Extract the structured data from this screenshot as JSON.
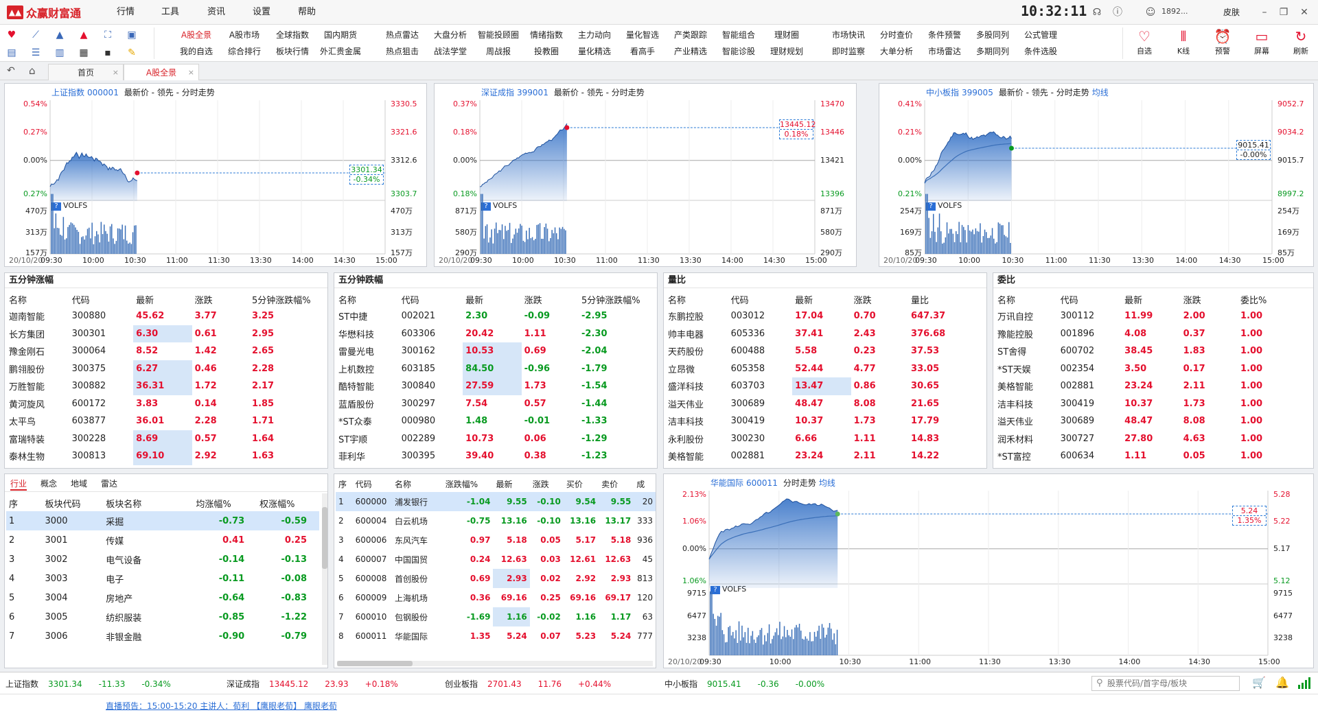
{
  "app": {
    "name": "众赢财富通",
    "menu": [
      "行情",
      "工具",
      "资讯",
      "设置",
      "帮助"
    ],
    "clock": "10:32:11",
    "user": "1892...",
    "skin": "皮肤"
  },
  "toolbar": {
    "row1": [
      "A股全景",
      "A股市场",
      "全球指数",
      "国内期货",
      "热点雷达",
      "大盘分析",
      "智能投顾圈",
      "情绪指数",
      "主力动向",
      "量化智选",
      "产类跟踪",
      "智能组合",
      "理财圈",
      "市场快讯",
      "分时查价",
      "条件预警",
      "多股同列",
      "公式管理"
    ],
    "row2": [
      "我的自选",
      "综合排行",
      "板块行情",
      "外汇贵金属",
      "热点狙击",
      "战法学堂",
      "周战报",
      "投教圈",
      "量化精选",
      "看高手",
      "产业精选",
      "智能诊股",
      "理财规划",
      "即时监察",
      "大单分析",
      "市场雷达",
      "多期同列",
      "条件选股"
    ],
    "right": [
      "自选",
      "K线",
      "预警",
      "屏幕",
      "刷新"
    ]
  },
  "tabs": [
    "首页",
    "A股全景"
  ],
  "charts": [
    {
      "name": "上证指数",
      "code": "000001",
      "desc": "最新价 - 领先 - 分时走势",
      "pct": [
        "0.54%",
        "0.27%",
        "0.00%",
        "0.27%"
      ],
      "price": [
        "3330.5",
        "3321.6",
        "3312.6",
        "3303.7"
      ],
      "tag_price": "3301.34",
      "tag_pct": "-0.34%",
      "vol_label": "VOLFS",
      "vol": [
        "470万",
        "313万",
        "157万"
      ],
      "date": "20/10/20",
      "times": [
        "09:30",
        "10:00",
        "10:30",
        "11:00",
        "11:30",
        "13:30",
        "14:00",
        "14:30",
        "15:00"
      ]
    },
    {
      "name": "深证成指",
      "code": "399001",
      "desc": "最新价 - 领先 - 分时走势",
      "pct": [
        "0.37%",
        "0.18%",
        "0.00%",
        "0.18%"
      ],
      "price": [
        "13470",
        "13446",
        "13421",
        "13396"
      ],
      "tag_price": "13445.12",
      "tag_pct": "0.18%",
      "vol_label": "VOLFS",
      "vol": [
        "871万",
        "580万",
        "290万"
      ],
      "date": "20/10/20",
      "times": [
        "09:30",
        "10:00",
        "10:30",
        "11:00",
        "11:30",
        "13:30",
        "14:00",
        "14:30",
        "15:00"
      ]
    },
    {
      "name": "中小板指",
      "code": "399005",
      "desc": "最新价 - 领先 - 分时走势",
      "extra": "均线",
      "pct": [
        "0.41%",
        "0.21%",
        "0.00%",
        "0.21%"
      ],
      "price": [
        "9052.7",
        "9034.2",
        "9015.7",
        "8997.2"
      ],
      "tag_price": "9015.41",
      "tag_pct": "-0.00%",
      "vol_label": "VOLFS",
      "vol": [
        "254万",
        "169万",
        "85万"
      ],
      "date": "20/10/20",
      "times": [
        "09:30",
        "10:00",
        "10:30",
        "11:00",
        "11:30",
        "13:30",
        "14:00",
        "14:30",
        "15:00"
      ]
    }
  ],
  "ranks": [
    {
      "title": "五分钟涨幅",
      "cols": [
        "名称",
        "代码",
        "最新",
        "涨跌",
        "5分钟涨跌幅%"
      ],
      "rows": [
        [
          "迦南智能",
          "300880",
          "45.62",
          "3.77",
          "3.25"
        ],
        [
          "长方集团",
          "300301",
          "6.30",
          "0.61",
          "2.95"
        ],
        [
          "豫金刚石",
          "300064",
          "8.52",
          "1.42",
          "2.65"
        ],
        [
          "鹏翎股份",
          "300375",
          "6.27",
          "0.46",
          "2.28"
        ],
        [
          "万胜智能",
          "300882",
          "36.31",
          "1.72",
          "2.17"
        ],
        [
          "黄河旋风",
          "600172",
          "3.83",
          "0.14",
          "1.85"
        ],
        [
          "太平鸟",
          "603877",
          "36.01",
          "2.28",
          "1.71"
        ],
        [
          "富瑞特装",
          "300228",
          "8.69",
          "0.57",
          "1.64"
        ],
        [
          "泰林生物",
          "300813",
          "69.10",
          "2.92",
          "1.63"
        ]
      ]
    },
    {
      "title": "五分钟跌幅",
      "cols": [
        "名称",
        "代码",
        "最新",
        "涨跌",
        "5分钟涨跌幅%"
      ],
      "rows": [
        [
          "ST中捷",
          "002021",
          "2.30",
          "-0.09",
          "-2.95"
        ],
        [
          "华懋科技",
          "603306",
          "20.42",
          "1.11",
          "-2.30"
        ],
        [
          "雷曼光电",
          "300162",
          "10.53",
          "0.69",
          "-2.04"
        ],
        [
          "上机数控",
          "603185",
          "84.50",
          "-0.96",
          "-1.79"
        ],
        [
          "酷特智能",
          "300840",
          "27.59",
          "1.73",
          "-1.54"
        ],
        [
          "蓝盾股份",
          "300297",
          "7.54",
          "0.57",
          "-1.44"
        ],
        [
          "*ST众泰",
          "000980",
          "1.48",
          "-0.01",
          "-1.33"
        ],
        [
          "ST宇顺",
          "002289",
          "10.73",
          "0.06",
          "-1.29"
        ],
        [
          "菲利华",
          "300395",
          "39.40",
          "0.38",
          "-1.23"
        ]
      ]
    },
    {
      "title": "量比",
      "cols": [
        "名称",
        "代码",
        "最新",
        "涨跌",
        "量比"
      ],
      "rows": [
        [
          "东鹏控股",
          "003012",
          "17.04",
          "0.70",
          "647.37"
        ],
        [
          "帅丰电器",
          "605336",
          "37.41",
          "2.43",
          "376.68"
        ],
        [
          "天药股份",
          "600488",
          "5.58",
          "0.23",
          "37.53"
        ],
        [
          "立昂微",
          "605358",
          "52.44",
          "4.77",
          "33.05"
        ],
        [
          "盛洋科技",
          "603703",
          "13.47",
          "0.86",
          "30.65"
        ],
        [
          "溢天伟业",
          "300689",
          "48.47",
          "8.08",
          "21.65"
        ],
        [
          "洁丰科技",
          "300419",
          "10.37",
          "1.73",
          "17.79"
        ],
        [
          "永利股份",
          "300230",
          "6.66",
          "1.11",
          "14.83"
        ],
        [
          "美格智能",
          "002881",
          "23.24",
          "2.11",
          "14.22"
        ]
      ]
    },
    {
      "title": "委比",
      "cols": [
        "名称",
        "代码",
        "最新",
        "涨跌",
        "委比%"
      ],
      "rows": [
        [
          "万讯自控",
          "300112",
          "11.99",
          "2.00",
          "1.00"
        ],
        [
          "豫能控股",
          "001896",
          "4.08",
          "0.37",
          "1.00"
        ],
        [
          "ST舍得",
          "600702",
          "38.45",
          "1.83",
          "1.00"
        ],
        [
          "*ST天娱",
          "002354",
          "3.50",
          "0.17",
          "1.00"
        ],
        [
          "美格智能",
          "002881",
          "23.24",
          "2.11",
          "1.00"
        ],
        [
          "洁丰科技",
          "300419",
          "10.37",
          "1.73",
          "1.00"
        ],
        [
          "溢天伟业",
          "300689",
          "48.47",
          "8.08",
          "1.00"
        ],
        [
          "润禾材料",
          "300727",
          "27.80",
          "4.63",
          "1.00"
        ],
        [
          "*ST富控",
          "600634",
          "1.11",
          "0.05",
          "1.00"
        ]
      ]
    }
  ],
  "sector": {
    "tabs": [
      "行业",
      "概念",
      "地域",
      "雷达"
    ],
    "cols": [
      "序",
      "板块代码",
      "板块名称",
      "均涨幅%",
      "权涨幅%"
    ],
    "rows": [
      [
        "1",
        "3000",
        "采掘",
        "-0.73",
        "-0.59"
      ],
      [
        "2",
        "3001",
        "传媒",
        "0.41",
        "0.25"
      ],
      [
        "3",
        "3002",
        "电气设备",
        "-0.14",
        "-0.13"
      ],
      [
        "4",
        "3003",
        "电子",
        "-0.11",
        "-0.08"
      ],
      [
        "5",
        "3004",
        "房地产",
        "-0.64",
        "-0.83"
      ],
      [
        "6",
        "3005",
        "纺织服装",
        "-0.85",
        "-1.22"
      ],
      [
        "7",
        "3006",
        "非银金融",
        "-0.90",
        "-0.79"
      ]
    ]
  },
  "stocks": {
    "cols": [
      "序",
      "代码",
      "名称",
      "涨跌幅%",
      "最新",
      "涨跌",
      "买价",
      "卖价",
      "成"
    ],
    "rows": [
      [
        "1",
        "600000",
        "浦发银行",
        "-1.04",
        "9.55",
        "-0.10",
        "9.54",
        "9.55",
        "20"
      ],
      [
        "2",
        "600004",
        "白云机场",
        "-0.75",
        "13.16",
        "-0.10",
        "13.16",
        "13.17",
        "333"
      ],
      [
        "3",
        "600006",
        "东风汽车",
        "0.97",
        "5.18",
        "0.05",
        "5.17",
        "5.18",
        "936"
      ],
      [
        "4",
        "600007",
        "中国国贸",
        "0.24",
        "12.63",
        "0.03",
        "12.61",
        "12.63",
        "45"
      ],
      [
        "5",
        "600008",
        "首创股份",
        "0.69",
        "2.93",
        "0.02",
        "2.92",
        "2.93",
        "813"
      ],
      [
        "6",
        "600009",
        "上海机场",
        "0.36",
        "69.16",
        "0.25",
        "69.16",
        "69.17",
        "120"
      ],
      [
        "7",
        "600010",
        "包钢股份",
        "-1.69",
        "1.16",
        "-0.02",
        "1.16",
        "1.17",
        "63"
      ],
      [
        "8",
        "600011",
        "华能国际",
        "1.35",
        "5.24",
        "0.07",
        "5.23",
        "5.24",
        "777"
      ]
    ]
  },
  "bigchart": {
    "name": "华能国际",
    "code": "600011",
    "desc": "分时走势",
    "extra": "均线",
    "pct": [
      "2.13%",
      "1.06%",
      "0.00%",
      "1.06%"
    ],
    "price": [
      "5.28",
      "5.22",
      "5.17",
      "5.12"
    ],
    "tag_price": "5.24",
    "tag_pct": "1.35%",
    "vol_label": "VOLFS",
    "vol": [
      "9715",
      "6477",
      "3238"
    ],
    "date": "20/10/20",
    "times": [
      "09:30",
      "10:00",
      "10:30",
      "11:00",
      "11:30",
      "13:30",
      "14:00",
      "14:30",
      "15:00"
    ]
  },
  "status": [
    {
      "name": "上证指数",
      "price": "3301.34",
      "chg": "-11.33",
      "pct": "-0.34%"
    },
    {
      "name": "深证成指",
      "price": "13445.12",
      "chg": "23.93",
      "pct": "+0.18%"
    },
    {
      "name": "创业板指",
      "price": "2701.43",
      "chg": "11.76",
      "pct": "+0.44%"
    },
    {
      "name": "中小板指",
      "price": "9015.41",
      "chg": "-0.36",
      "pct": "-0.00%"
    }
  ],
  "search": {
    "placeholder": "股票代码/首字母/板块"
  },
  "news": "直播预告：15:00-15:20 主讲人：荀利 【鹰眼老荀】 鹰眼老荀"
}
